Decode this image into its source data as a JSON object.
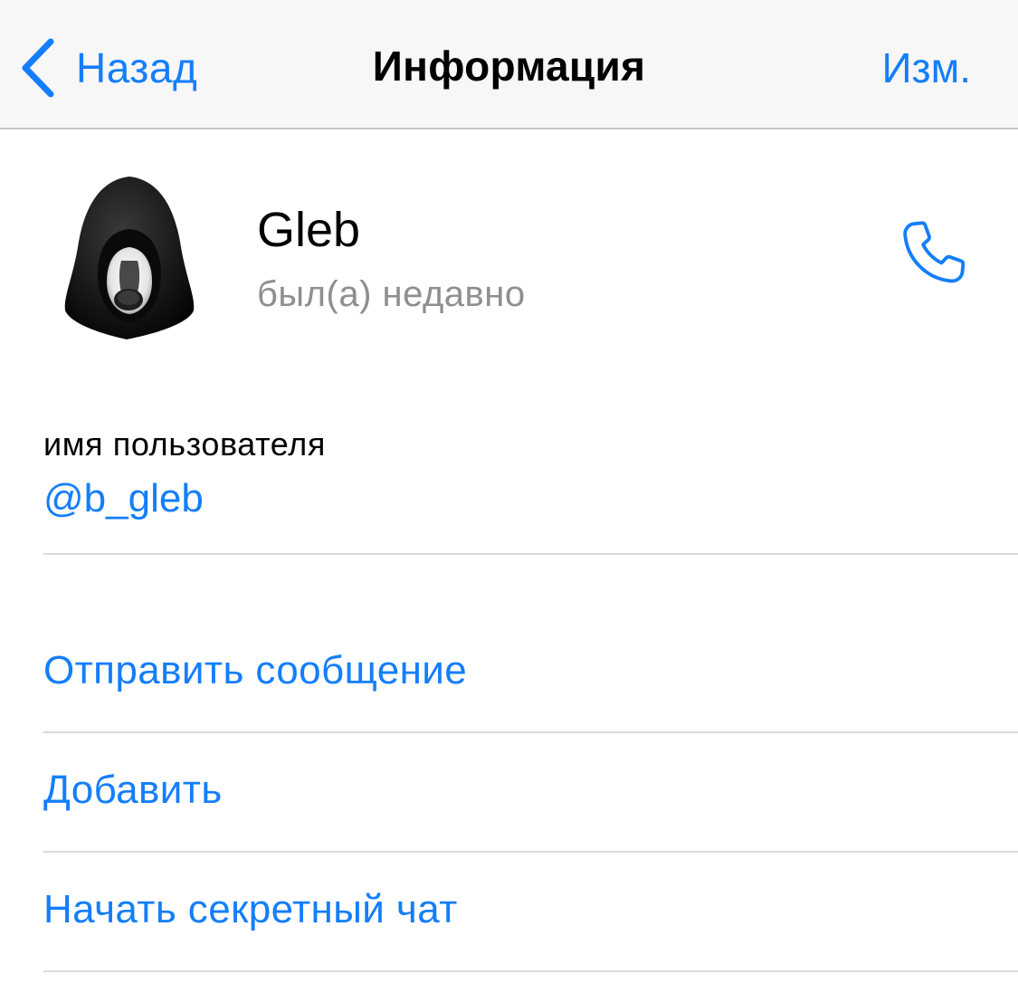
{
  "navbar": {
    "back_icon": "chevron-left-icon",
    "back_label": "Назад",
    "title": "Информация",
    "edit_label": "Изм."
  },
  "profile": {
    "avatar_icon": "hooded-figure-avatar",
    "name": "Gleb",
    "status": "был(а) недавно",
    "call_icon": "phone-icon"
  },
  "info": {
    "label": "имя пользователя",
    "value": "@b_gleb"
  },
  "actions": [
    {
      "label": "Отправить сообщение"
    },
    {
      "label": "Добавить"
    },
    {
      "label": "Начать секретный чат"
    }
  ],
  "colors": {
    "accent": "#147efb",
    "secondary_text": "#8e8e93",
    "navbar_bg": "#f7f7f7",
    "separator": "#d9d9de"
  }
}
